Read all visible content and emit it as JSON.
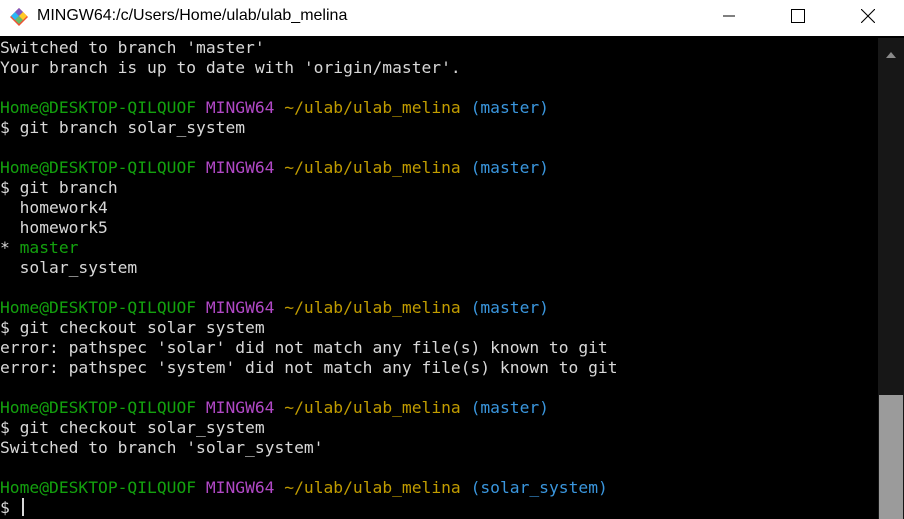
{
  "window": {
    "title": "MINGW64:/c/Users/Home/ulab/ulab_melina",
    "icons": {
      "app": "git-bash-icon",
      "minimize": "minimize-icon",
      "maximize": "maximize-icon",
      "close": "close-icon"
    }
  },
  "terminal": {
    "lines": [
      {
        "kind": "text",
        "text": "Switched to branch 'master'"
      },
      {
        "kind": "text",
        "text": "Your branch is up to date with 'origin/master'."
      },
      {
        "kind": "blank",
        "text": ""
      },
      {
        "kind": "prompt",
        "user": "Home@DESKTOP-QILQUOF",
        "env": "MINGW64",
        "path": "~/ulab/ulab_melina",
        "branch": "(master)"
      },
      {
        "kind": "text",
        "text": "$ git branch solar_system"
      },
      {
        "kind": "blank",
        "text": ""
      },
      {
        "kind": "prompt",
        "user": "Home@DESKTOP-QILQUOF",
        "env": "MINGW64",
        "path": "~/ulab/ulab_melina",
        "branch": "(master)"
      },
      {
        "kind": "text",
        "text": "$ git branch"
      },
      {
        "kind": "text",
        "text": "  homework4"
      },
      {
        "kind": "text",
        "text": "  homework5"
      },
      {
        "kind": "current",
        "marker": "* ",
        "text": "master"
      },
      {
        "kind": "text",
        "text": "  solar_system"
      },
      {
        "kind": "blank",
        "text": ""
      },
      {
        "kind": "prompt",
        "user": "Home@DESKTOP-QILQUOF",
        "env": "MINGW64",
        "path": "~/ulab/ulab_melina",
        "branch": "(master)"
      },
      {
        "kind": "text",
        "text": "$ git checkout solar system"
      },
      {
        "kind": "text",
        "text": "error: pathspec 'solar' did not match any file(s) known to git"
      },
      {
        "kind": "text",
        "text": "error: pathspec 'system' did not match any file(s) known to git"
      },
      {
        "kind": "blank",
        "text": ""
      },
      {
        "kind": "prompt",
        "user": "Home@DESKTOP-QILQUOF",
        "env": "MINGW64",
        "path": "~/ulab/ulab_melina",
        "branch": "(master)"
      },
      {
        "kind": "text",
        "text": "$ git checkout solar_system"
      },
      {
        "kind": "text",
        "text": "Switched to branch 'solar_system'"
      },
      {
        "kind": "blank",
        "text": ""
      },
      {
        "kind": "prompt",
        "user": "Home@DESKTOP-QILQUOF",
        "env": "MINGW64",
        "path": "~/ulab/ulab_melina",
        "branch": "(solar_system)"
      },
      {
        "kind": "input",
        "text": "$ "
      }
    ]
  },
  "colors": {
    "user": "#13a10e",
    "env": "#b148c6",
    "path": "#c19c00",
    "branch": "#3a96dd",
    "text": "#d8d8d8",
    "background": "#000000"
  }
}
